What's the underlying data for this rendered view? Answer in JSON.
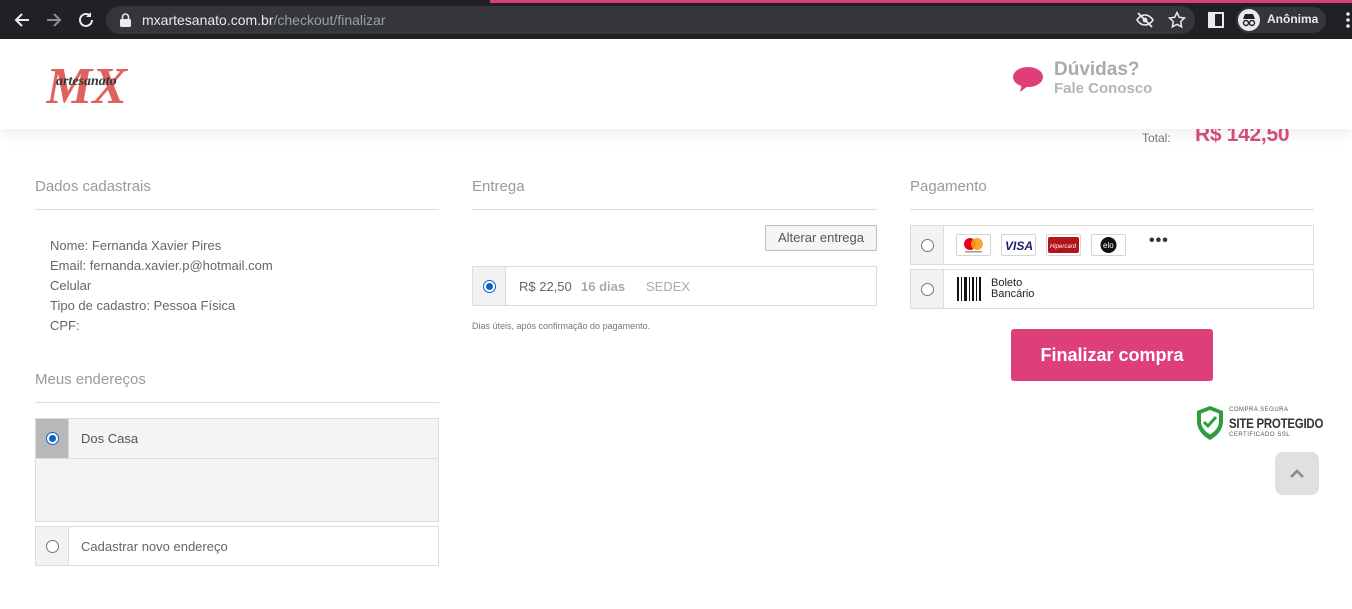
{
  "browser": {
    "url_domain": "mxartesanato.com.br",
    "url_path": "/checkout/finalizar",
    "profile_label": "Anônima"
  },
  "header": {
    "logo_mark": "MX",
    "logo_text": "artesanato",
    "help_title": "Dúvidas?",
    "help_subtitle": "Fale Conosco"
  },
  "total": {
    "label": "Total:",
    "value": "R$ 142,50"
  },
  "dados": {
    "title": "Dados cadastrais",
    "lines": [
      "Nome: Fernanda Xavier Pires",
      "Email: fernanda.xavier.p@hotmail.com",
      "Celular",
      "Tipo de cadastro: Pessoa Física",
      "CPF:"
    ]
  },
  "enderecos": {
    "title": "Meus endereços",
    "items": [
      {
        "label": "Dos Casa",
        "selected": true
      },
      {
        "label": "Cadastrar novo endereço",
        "selected": false
      }
    ]
  },
  "entrega": {
    "title": "Entrega",
    "change_button": "Alterar entrega",
    "option": {
      "price": "R$ 22,50",
      "days": "16 dias",
      "carrier": "SEDEX",
      "selected": true
    },
    "note": "Dias úteis, após confirmação do pagamento."
  },
  "pagamento": {
    "title": "Pagamento",
    "card_brands": [
      "mastercard",
      "VISA",
      "Hipercard",
      "elo"
    ],
    "more": "•••",
    "boleto_line1": "Boleto",
    "boleto_line2": "Bancário",
    "submit": "Finalizar compra"
  },
  "seal": {
    "line1": "COMPRA SEGURA",
    "line2": "SITE PROTEGIDO",
    "line3": "CERTIFICADO SSL"
  },
  "colors": {
    "brand": "#de3f79",
    "total": "#d94d82",
    "seal_green": "#2e9d3f"
  }
}
